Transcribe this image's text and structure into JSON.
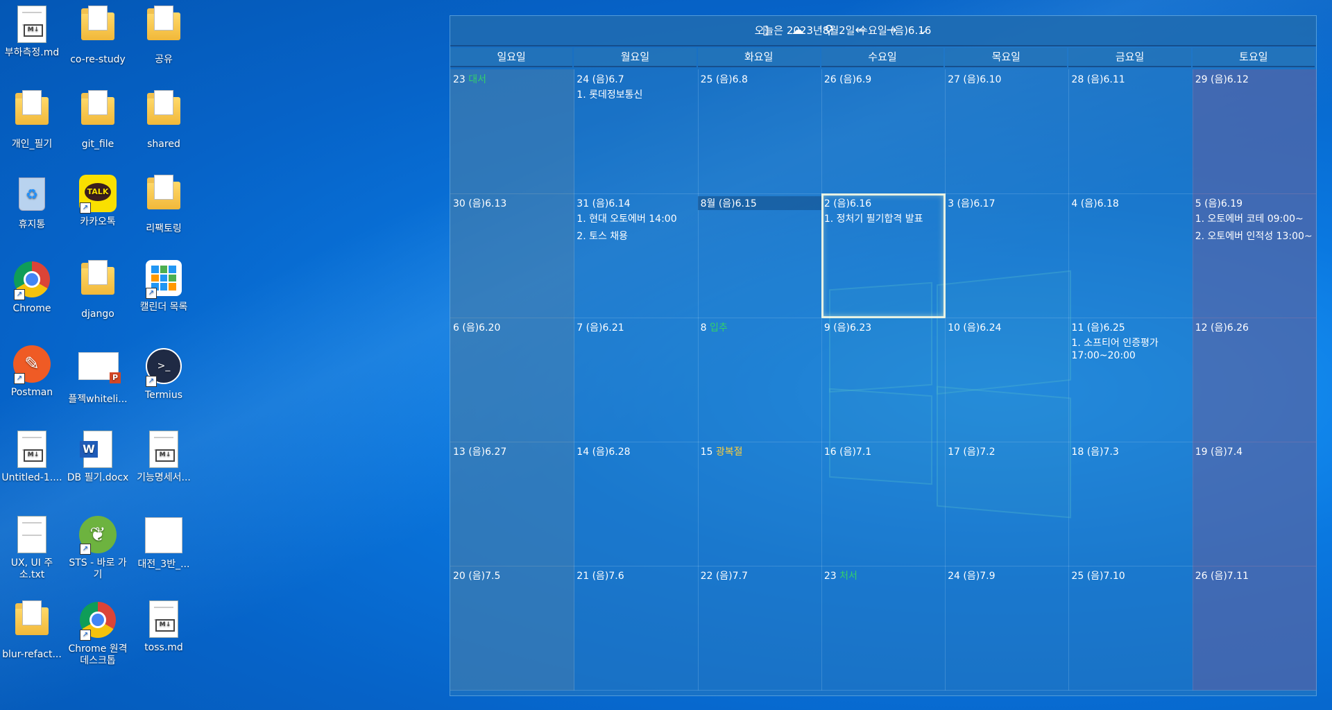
{
  "desktop": {
    "icons": [
      {
        "label": "부하측정.md",
        "kind": "md"
      },
      {
        "label": "co-re-study",
        "kind": "folder"
      },
      {
        "label": "공유",
        "kind": "folder"
      },
      {
        "label": "개인_필기",
        "kind": "folder"
      },
      {
        "label": "git_file",
        "kind": "folder"
      },
      {
        "label": "shared",
        "kind": "folder"
      },
      {
        "label": "휴지통",
        "kind": "recycle"
      },
      {
        "label": "카카오톡",
        "kind": "kakao"
      },
      {
        "label": "리팩토링",
        "kind": "folder"
      },
      {
        "label": "Chrome",
        "kind": "chrome"
      },
      {
        "label": "django",
        "kind": "folder"
      },
      {
        "label": "캘린더 목록",
        "kind": "calendar-app"
      },
      {
        "label": "Postman",
        "kind": "postman"
      },
      {
        "label": "플젝whiteli...",
        "kind": "pptx"
      },
      {
        "label": "Termius",
        "kind": "termius"
      },
      {
        "label": "Untitled-1....",
        "kind": "md"
      },
      {
        "label": "DB 필기.docx",
        "kind": "docx"
      },
      {
        "label": "기능명세서...",
        "kind": "md"
      },
      {
        "label": "UX, UI 주소.txt",
        "kind": "txt"
      },
      {
        "label": "STS - 바로 가기",
        "kind": "sts"
      },
      {
        "label": "대전_3반_...",
        "kind": "image"
      },
      {
        "label": "blur-refact...",
        "kind": "folder"
      },
      {
        "label": "Chrome 원격 데스크톱",
        "kind": "chrome-remote"
      },
      {
        "label": "toss.md",
        "kind": "md"
      }
    ]
  },
  "calendar": {
    "title": "오늘은 2023년8월2일 수요일 (음)6.16",
    "buttons": [
      {
        "name": "phone-icon",
        "glyph": "▯"
      },
      {
        "name": "cloud-sync-icon",
        "glyph": "☁"
      },
      {
        "name": "user-icon",
        "glyph": "⚲"
      },
      {
        "name": "prev-arrow-icon",
        "glyph": "←"
      },
      {
        "name": "next-arrow-icon",
        "glyph": "→"
      },
      {
        "name": "chevron-down-icon",
        "glyph": "⌄"
      }
    ],
    "weekdays": [
      "일요일",
      "월요일",
      "화요일",
      "수요일",
      "목요일",
      "금요일",
      "토요일"
    ],
    "weeks": [
      [
        {
          "date": "23",
          "lunar": "",
          "holiday": "대서",
          "holiday_color": "green",
          "events": []
        },
        {
          "date": "24",
          "lunar": "(음)6.7",
          "events": [
            "1. 롯데정보통신"
          ]
        },
        {
          "date": "25",
          "lunar": "(음)6.8",
          "events": []
        },
        {
          "date": "26",
          "lunar": "(음)6.9",
          "events": []
        },
        {
          "date": "27",
          "lunar": "(음)6.10",
          "events": []
        },
        {
          "date": "28",
          "lunar": "(음)6.11",
          "events": []
        },
        {
          "date": "29",
          "lunar": "(음)6.12",
          "events": []
        }
      ],
      [
        {
          "date": "30",
          "lunar": "(음)6.13",
          "events": []
        },
        {
          "date": "31",
          "lunar": "(음)6.14",
          "events": [
            "1. 현대 오토에버 14:00",
            "2. 토스 채용"
          ]
        },
        {
          "date": "8월",
          "lunar": "(음)6.15",
          "events": [],
          "highlight": true
        },
        {
          "date": "2",
          "lunar": "(음)6.16",
          "events": [
            "1. 정처기 필기합격 발표"
          ],
          "today": true
        },
        {
          "date": "3",
          "lunar": "(음)6.17",
          "events": []
        },
        {
          "date": "4",
          "lunar": "(음)6.18",
          "events": []
        },
        {
          "date": "5",
          "lunar": "(음)6.19",
          "events": [
            "1. 오토에버 코테 09:00~",
            "2. 오토에버 인적성 13:00~"
          ]
        }
      ],
      [
        {
          "date": "6",
          "lunar": "(음)6.20",
          "events": []
        },
        {
          "date": "7",
          "lunar": "(음)6.21",
          "events": []
        },
        {
          "date": "8",
          "lunar": "",
          "holiday": "입추",
          "holiday_color": "green",
          "events": []
        },
        {
          "date": "9",
          "lunar": "(음)6.23",
          "events": []
        },
        {
          "date": "10",
          "lunar": "(음)6.24",
          "events": []
        },
        {
          "date": "11",
          "lunar": "(음)6.25",
          "events": [
            "1. 소프티어 인증평가",
            "17:00~20:00"
          ]
        },
        {
          "date": "12",
          "lunar": "(음)6.26",
          "events": []
        }
      ],
      [
        {
          "date": "13",
          "lunar": "(음)6.27",
          "events": []
        },
        {
          "date": "14",
          "lunar": "(음)6.28",
          "events": []
        },
        {
          "date": "15",
          "lunar": "",
          "holiday": "광복절",
          "holiday_color": "yellow",
          "events": []
        },
        {
          "date": "16",
          "lunar": "(음)7.1",
          "events": []
        },
        {
          "date": "17",
          "lunar": "(음)7.2",
          "events": []
        },
        {
          "date": "18",
          "lunar": "(음)7.3",
          "events": []
        },
        {
          "date": "19",
          "lunar": "(음)7.4",
          "events": []
        }
      ],
      [
        {
          "date": "20",
          "lunar": "(음)7.5",
          "events": []
        },
        {
          "date": "21",
          "lunar": "(음)7.6",
          "events": []
        },
        {
          "date": "22",
          "lunar": "(음)7.7",
          "events": []
        },
        {
          "date": "23",
          "lunar": "",
          "holiday": "처서",
          "holiday_color": "green",
          "events": []
        },
        {
          "date": "24",
          "lunar": "(음)7.9",
          "events": []
        },
        {
          "date": "25",
          "lunar": "(음)7.10",
          "events": []
        },
        {
          "date": "26",
          "lunar": "(음)7.11",
          "events": []
        }
      ]
    ]
  }
}
